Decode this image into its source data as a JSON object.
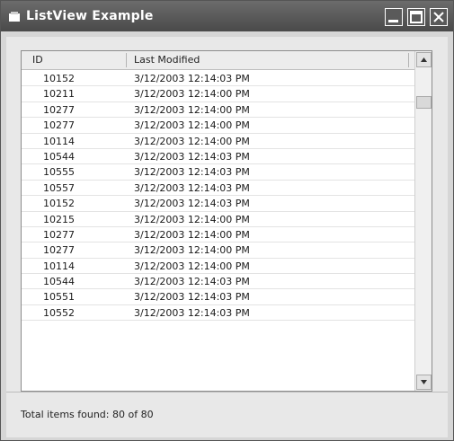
{
  "window": {
    "title": "ListView Example",
    "icon": "app-icon",
    "buttons": [
      "minimize-icon",
      "maximize-icon",
      "close-icon"
    ]
  },
  "listview": {
    "columns": [
      "ID",
      "Last Modified"
    ],
    "rows": [
      {
        "id": "10152",
        "modified": "3/12/2003 12:14:03 PM"
      },
      {
        "id": "10211",
        "modified": "3/12/2003 12:14:00 PM"
      },
      {
        "id": "10277",
        "modified": "3/12/2003 12:14:00 PM"
      },
      {
        "id": "10277",
        "modified": "3/12/2003 12:14:00 PM"
      },
      {
        "id": "10114",
        "modified": "3/12/2003 12:14:00 PM"
      },
      {
        "id": "10544",
        "modified": "3/12/2003 12:14:03 PM"
      },
      {
        "id": "10555",
        "modified": "3/12/2003 12:14:03 PM"
      },
      {
        "id": "10557",
        "modified": "3/12/2003 12:14:03 PM"
      },
      {
        "id": "10152",
        "modified": "3/12/2003 12:14:03 PM"
      },
      {
        "id": "10215",
        "modified": "3/12/2003 12:14:00 PM"
      },
      {
        "id": "10277",
        "modified": "3/12/2003 12:14:00 PM"
      },
      {
        "id": "10277",
        "modified": "3/12/2003 12:14:00 PM"
      },
      {
        "id": "10114",
        "modified": "3/12/2003 12:14:00 PM"
      },
      {
        "id": "10544",
        "modified": "3/12/2003 12:14:03 PM"
      },
      {
        "id": "10551",
        "modified": "3/12/2003 12:14:03 PM"
      },
      {
        "id": "10552",
        "modified": "3/12/2003 12:14:03 PM"
      }
    ]
  },
  "status": {
    "text": "Total items found: 80 of 80"
  }
}
